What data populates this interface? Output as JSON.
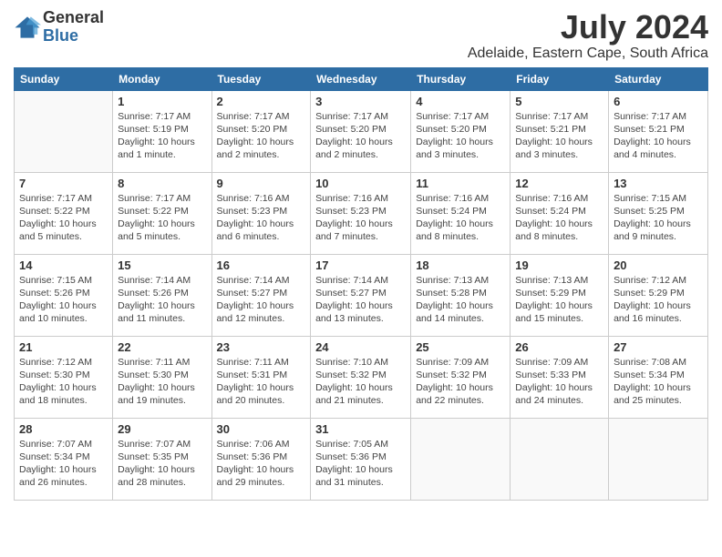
{
  "header": {
    "logo_general": "General",
    "logo_blue": "Blue",
    "month_year": "July 2024",
    "location": "Adelaide, Eastern Cape, South Africa"
  },
  "days_of_week": [
    "Sunday",
    "Monday",
    "Tuesday",
    "Wednesday",
    "Thursday",
    "Friday",
    "Saturday"
  ],
  "weeks": [
    [
      {
        "day": "",
        "info": ""
      },
      {
        "day": "1",
        "info": "Sunrise: 7:17 AM\nSunset: 5:19 PM\nDaylight: 10 hours\nand 1 minute."
      },
      {
        "day": "2",
        "info": "Sunrise: 7:17 AM\nSunset: 5:20 PM\nDaylight: 10 hours\nand 2 minutes."
      },
      {
        "day": "3",
        "info": "Sunrise: 7:17 AM\nSunset: 5:20 PM\nDaylight: 10 hours\nand 2 minutes."
      },
      {
        "day": "4",
        "info": "Sunrise: 7:17 AM\nSunset: 5:20 PM\nDaylight: 10 hours\nand 3 minutes."
      },
      {
        "day": "5",
        "info": "Sunrise: 7:17 AM\nSunset: 5:21 PM\nDaylight: 10 hours\nand 3 minutes."
      },
      {
        "day": "6",
        "info": "Sunrise: 7:17 AM\nSunset: 5:21 PM\nDaylight: 10 hours\nand 4 minutes."
      }
    ],
    [
      {
        "day": "7",
        "info": "Sunrise: 7:17 AM\nSunset: 5:22 PM\nDaylight: 10 hours\nand 5 minutes."
      },
      {
        "day": "8",
        "info": "Sunrise: 7:17 AM\nSunset: 5:22 PM\nDaylight: 10 hours\nand 5 minutes."
      },
      {
        "day": "9",
        "info": "Sunrise: 7:16 AM\nSunset: 5:23 PM\nDaylight: 10 hours\nand 6 minutes."
      },
      {
        "day": "10",
        "info": "Sunrise: 7:16 AM\nSunset: 5:23 PM\nDaylight: 10 hours\nand 7 minutes."
      },
      {
        "day": "11",
        "info": "Sunrise: 7:16 AM\nSunset: 5:24 PM\nDaylight: 10 hours\nand 8 minutes."
      },
      {
        "day": "12",
        "info": "Sunrise: 7:16 AM\nSunset: 5:24 PM\nDaylight: 10 hours\nand 8 minutes."
      },
      {
        "day": "13",
        "info": "Sunrise: 7:15 AM\nSunset: 5:25 PM\nDaylight: 10 hours\nand 9 minutes."
      }
    ],
    [
      {
        "day": "14",
        "info": "Sunrise: 7:15 AM\nSunset: 5:26 PM\nDaylight: 10 hours\nand 10 minutes."
      },
      {
        "day": "15",
        "info": "Sunrise: 7:14 AM\nSunset: 5:26 PM\nDaylight: 10 hours\nand 11 minutes."
      },
      {
        "day": "16",
        "info": "Sunrise: 7:14 AM\nSunset: 5:27 PM\nDaylight: 10 hours\nand 12 minutes."
      },
      {
        "day": "17",
        "info": "Sunrise: 7:14 AM\nSunset: 5:27 PM\nDaylight: 10 hours\nand 13 minutes."
      },
      {
        "day": "18",
        "info": "Sunrise: 7:13 AM\nSunset: 5:28 PM\nDaylight: 10 hours\nand 14 minutes."
      },
      {
        "day": "19",
        "info": "Sunrise: 7:13 AM\nSunset: 5:29 PM\nDaylight: 10 hours\nand 15 minutes."
      },
      {
        "day": "20",
        "info": "Sunrise: 7:12 AM\nSunset: 5:29 PM\nDaylight: 10 hours\nand 16 minutes."
      }
    ],
    [
      {
        "day": "21",
        "info": "Sunrise: 7:12 AM\nSunset: 5:30 PM\nDaylight: 10 hours\nand 18 minutes."
      },
      {
        "day": "22",
        "info": "Sunrise: 7:11 AM\nSunset: 5:30 PM\nDaylight: 10 hours\nand 19 minutes."
      },
      {
        "day": "23",
        "info": "Sunrise: 7:11 AM\nSunset: 5:31 PM\nDaylight: 10 hours\nand 20 minutes."
      },
      {
        "day": "24",
        "info": "Sunrise: 7:10 AM\nSunset: 5:32 PM\nDaylight: 10 hours\nand 21 minutes."
      },
      {
        "day": "25",
        "info": "Sunrise: 7:09 AM\nSunset: 5:32 PM\nDaylight: 10 hours\nand 22 minutes."
      },
      {
        "day": "26",
        "info": "Sunrise: 7:09 AM\nSunset: 5:33 PM\nDaylight: 10 hours\nand 24 minutes."
      },
      {
        "day": "27",
        "info": "Sunrise: 7:08 AM\nSunset: 5:34 PM\nDaylight: 10 hours\nand 25 minutes."
      }
    ],
    [
      {
        "day": "28",
        "info": "Sunrise: 7:07 AM\nSunset: 5:34 PM\nDaylight: 10 hours\nand 26 minutes."
      },
      {
        "day": "29",
        "info": "Sunrise: 7:07 AM\nSunset: 5:35 PM\nDaylight: 10 hours\nand 28 minutes."
      },
      {
        "day": "30",
        "info": "Sunrise: 7:06 AM\nSunset: 5:36 PM\nDaylight: 10 hours\nand 29 minutes."
      },
      {
        "day": "31",
        "info": "Sunrise: 7:05 AM\nSunset: 5:36 PM\nDaylight: 10 hours\nand 31 minutes."
      },
      {
        "day": "",
        "info": ""
      },
      {
        "day": "",
        "info": ""
      },
      {
        "day": "",
        "info": ""
      }
    ]
  ]
}
